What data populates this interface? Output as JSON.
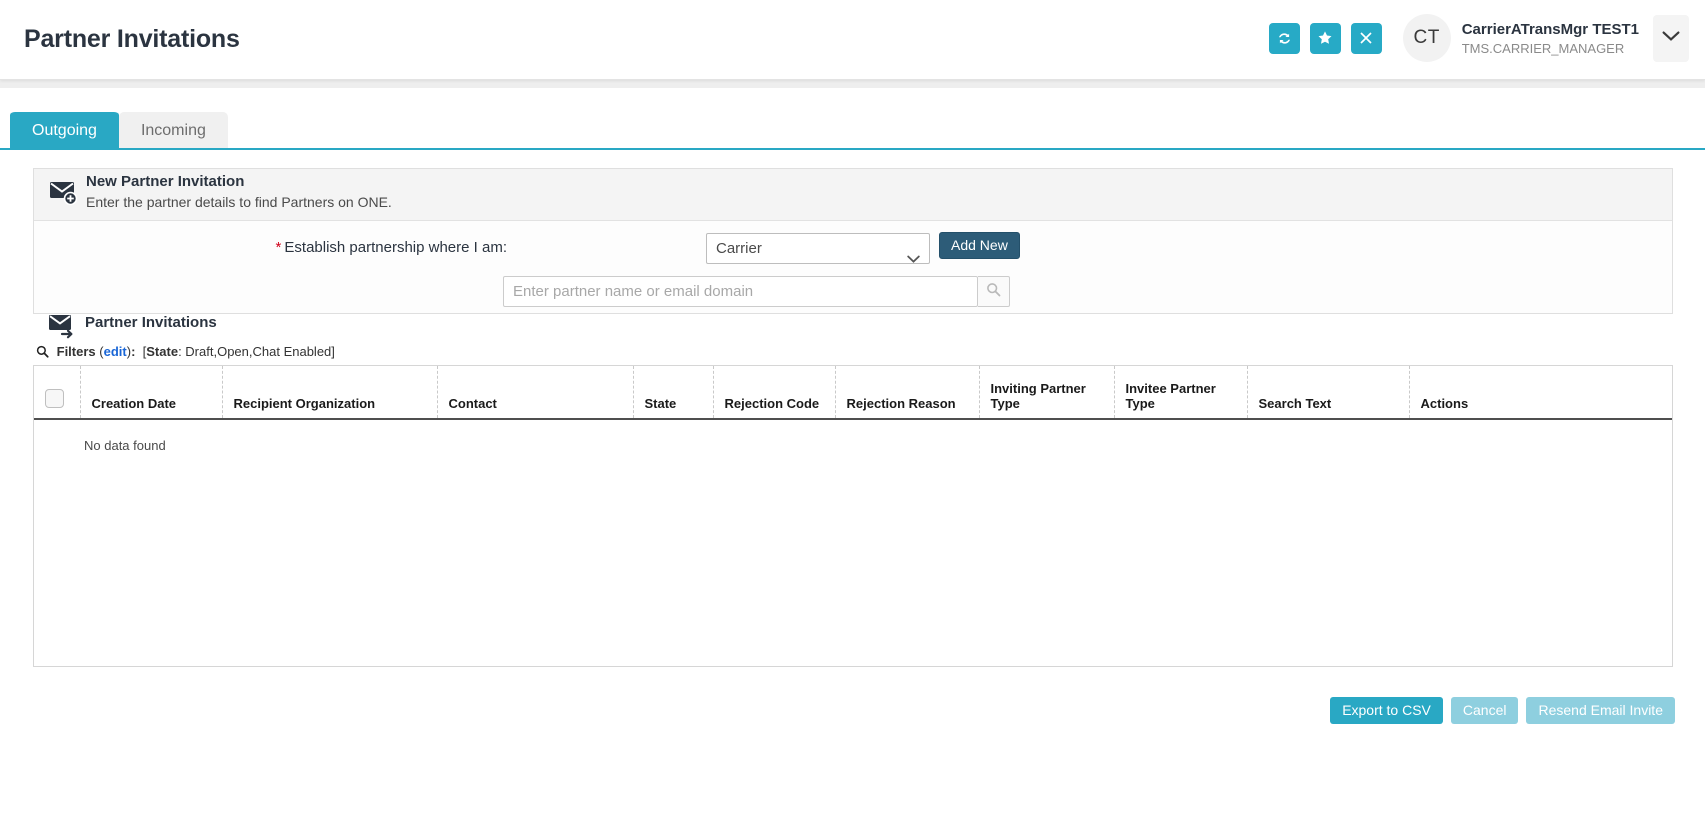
{
  "header": {
    "title": "Partner Invitations",
    "actions": [
      {
        "name": "refresh-icon",
        "label": "Refresh"
      },
      {
        "name": "favorite-star-icon",
        "label": "Favorite"
      },
      {
        "name": "close-x-icon",
        "label": "Close"
      }
    ],
    "avatar_initials": "CT",
    "user_name": "CarrierATransMgr TEST1",
    "user_role": "TMS.CARRIER_MANAGER",
    "caret_name": "chevron-down-icon",
    "accent_color": "#29a8c4"
  },
  "tabs": [
    {
      "label": "Outgoing",
      "active": true
    },
    {
      "label": "Incoming",
      "active": false
    }
  ],
  "new_invitation": {
    "icon": "envelope-plus-icon",
    "title": "New Partner Invitation",
    "subtitle": "Enter the partner details to find Partners on ONE.",
    "required_marker": "*",
    "field_label": "Establish partnership where I am:",
    "select_value": "Carrier",
    "select_options": [
      "Carrier"
    ],
    "add_new_label": "Add New",
    "add_new_color": "#2d5c78",
    "search_placeholder": "Enter partner name or email domain",
    "search_value": "",
    "search_icon": "magnifier-icon"
  },
  "grid": {
    "icon": "envelope-arrow-icon",
    "title": "Partner Invitations",
    "filters": {
      "icon": "magnifier-icon",
      "label": "Filters",
      "edit_label": "edit",
      "separator": ":",
      "state_key": "State",
      "state_value": "Draft,Open,Chat Enabled",
      "open_bracket": "[",
      "close_bracket": "]"
    },
    "columns": [
      "Creation Date",
      "Recipient Organization",
      "Contact",
      "State",
      "Rejection Code",
      "Rejection Reason",
      "Inviting Partner Type",
      "Invitee Partner Type",
      "Search Text",
      "Actions"
    ],
    "rows": [],
    "empty_message": "No data found"
  },
  "footer": {
    "buttons": [
      {
        "label": "Export to CSV",
        "state": "enabled"
      },
      {
        "label": "Cancel",
        "state": "disabled"
      },
      {
        "label": "Resend Email Invite",
        "state": "disabled"
      }
    ]
  }
}
